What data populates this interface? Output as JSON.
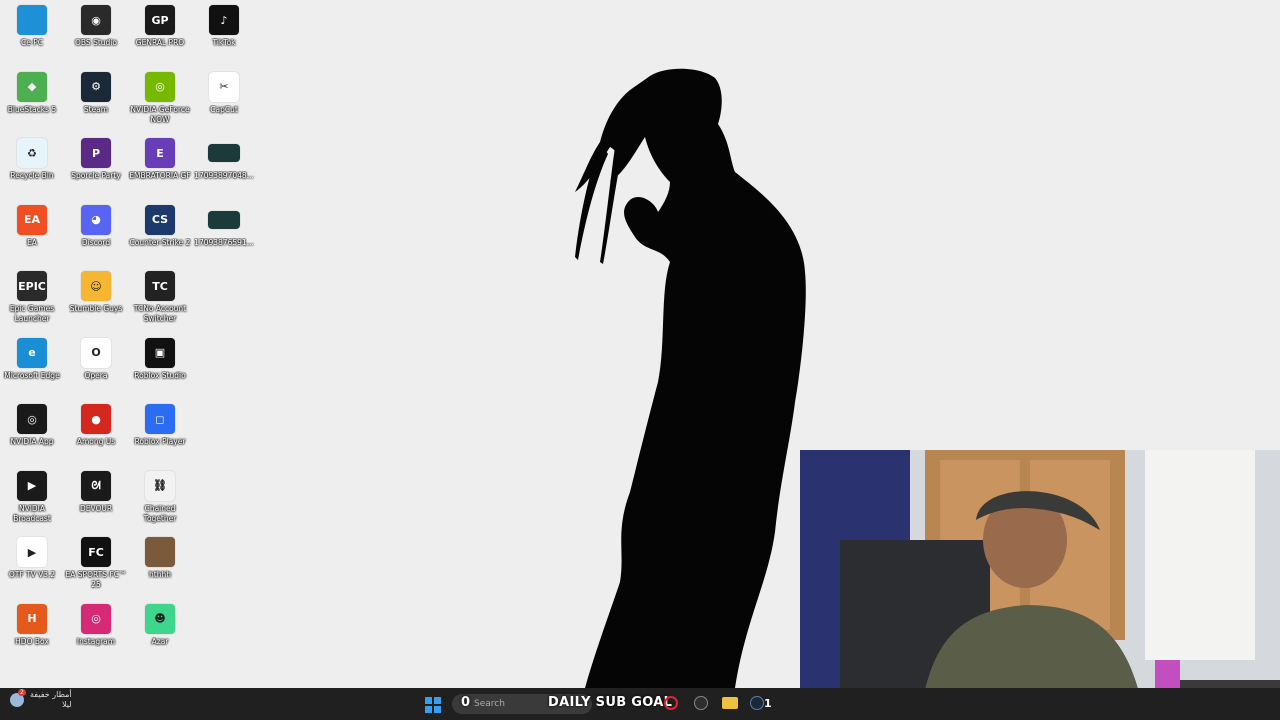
{
  "desktop": {
    "icons": [
      {
        "label": "Ce PC",
        "icon": "computer-icon",
        "color": "#1e90d6",
        "text": ""
      },
      {
        "label": "OBS Studio",
        "icon": "obs-icon",
        "color": "#2a2a2a",
        "text": "◉"
      },
      {
        "label": "GENRAL PRO",
        "icon": "genral-pro-icon",
        "color": "#1a1a1a",
        "text": "GP"
      },
      {
        "label": "TikTok",
        "icon": "tiktok-icon",
        "color": "#111111",
        "text": "♪"
      },
      {
        "label": "BlueStacks 5",
        "icon": "bluestacks-icon",
        "color": "#4caf50",
        "text": "◆"
      },
      {
        "label": "Steam",
        "icon": "steam-icon",
        "color": "#1b2838",
        "text": "⚙"
      },
      {
        "label": "NVIDIA GeForce NOW",
        "icon": "geforce-now-icon",
        "color": "#76b900",
        "text": "◎"
      },
      {
        "label": "CapCut",
        "icon": "capcut-icon",
        "color": "#ffffff",
        "text": "✂"
      },
      {
        "label": "Recycle Bin",
        "icon": "recycle-bin-icon",
        "color": "#e8f4fb",
        "text": "♻"
      },
      {
        "label": "Sporcle Party",
        "icon": "sporcle-party-icon",
        "color": "#5b2a86",
        "text": "P"
      },
      {
        "label": "EMBRATORIA GF",
        "icon": "embratoria-icon",
        "color": "#6a3db8",
        "text": "E"
      },
      {
        "label": "17093897048...",
        "icon": "video-thumbnail-icon",
        "color": "#1d3a3a",
        "text": ""
      },
      {
        "label": "EA",
        "icon": "ea-icon",
        "color": "#f04e23",
        "text": "EA"
      },
      {
        "label": "Discord",
        "icon": "discord-icon",
        "color": "#5865f2",
        "text": "◕"
      },
      {
        "label": "Counter-Strike 2",
        "icon": "counter-strike-icon",
        "color": "#1c3a6b",
        "text": "CS"
      },
      {
        "label": "17093876591...",
        "icon": "video-thumbnail-icon",
        "color": "#1d3a3a",
        "text": ""
      },
      {
        "label": "Epic Games Launcher",
        "icon": "epic-games-icon",
        "color": "#2a2a2a",
        "text": "EPIC"
      },
      {
        "label": "Stumble Guys",
        "icon": "stumble-guys-icon",
        "color": "#f5b731",
        "text": "☺"
      },
      {
        "label": "TCNo Account Switcher",
        "icon": "tcno-icon",
        "color": "#222222",
        "text": "TC"
      },
      {
        "label": "",
        "icon": "",
        "color": "",
        "text": ""
      },
      {
        "label": "Microsoft Edge",
        "icon": "edge-icon",
        "color": "#1a8fd6",
        "text": "e"
      },
      {
        "label": "Opera",
        "icon": "opera-icon",
        "color": "#ffffff",
        "text": "O"
      },
      {
        "label": "Roblox Studio",
        "icon": "roblox-studio-icon",
        "color": "#111111",
        "text": "▣"
      },
      {
        "label": "",
        "icon": "",
        "color": "",
        "text": ""
      },
      {
        "label": "NVIDIA App",
        "icon": "nvidia-app-icon",
        "color": "#1a1a1a",
        "text": "◎"
      },
      {
        "label": "Among Us",
        "icon": "among-us-icon",
        "color": "#d4281e",
        "text": "●"
      },
      {
        "label": "Roblox Player",
        "icon": "roblox-player-icon",
        "color": "#2b6cf0",
        "text": "◻"
      },
      {
        "label": "",
        "icon": "",
        "color": "",
        "text": ""
      },
      {
        "label": "NVIDIA Broadcast",
        "icon": "nvidia-broadcast-icon",
        "color": "#1a1a1a",
        "text": "▶"
      },
      {
        "label": "DEVOUR",
        "icon": "devour-icon",
        "color": "#1a1a1a",
        "text": "ᘛ"
      },
      {
        "label": "Chained Together",
        "icon": "chained-together-icon",
        "color": "#f2f2f2",
        "text": "⛓"
      },
      {
        "label": "",
        "icon": "",
        "color": "",
        "text": ""
      },
      {
        "label": "OTF TV V3.2",
        "icon": "otf-tv-icon",
        "color": "#ffffff",
        "text": "▶"
      },
      {
        "label": "EA SPORTS FC™ 25",
        "icon": "ea-sports-fc-icon",
        "color": "#111111",
        "text": "FC"
      },
      {
        "label": "hthhh",
        "icon": "photo-icon",
        "color": "#7a5a3a",
        "text": ""
      },
      {
        "label": "",
        "icon": "",
        "color": "",
        "text": ""
      },
      {
        "label": "HDO Box",
        "icon": "hdo-box-icon",
        "color": "#e35a1c",
        "text": "H"
      },
      {
        "label": "Instagram",
        "icon": "instagram-icon",
        "color": "#d62976",
        "text": "◎"
      },
      {
        "label": "Azar",
        "icon": "azar-icon",
        "color": "#3dd68c",
        "text": "☻"
      }
    ]
  },
  "taskbar": {
    "weather_text": "أمطار خفيفة",
    "weather_sub": "ليلا",
    "weather_badge": "2",
    "search_placeholder": "Search",
    "overlay_goal": "DAILY SUB GOAL",
    "overlay_count": "0",
    "steam_badge": "1"
  }
}
